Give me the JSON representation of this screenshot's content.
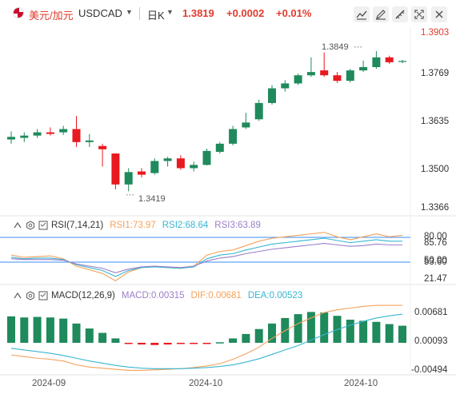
{
  "header": {
    "pair_cn": "美元/加元",
    "pair_code": "USDCAD",
    "period": "日K",
    "price": "1.3819",
    "change": "+0.0002",
    "change_pct": "+0.01%"
  },
  "toolbar": {
    "icons": [
      "chart-line-icon",
      "draw-pencil-icon",
      "ruler-icon",
      "fullscreen-icon",
      "close-icon"
    ]
  },
  "colors": {
    "up": "#1f8a5c",
    "down": "#e8191f",
    "accent_red": "#e23b2e",
    "rsi1": "#f5a15a",
    "rsi2": "#37b6d1",
    "rsi3": "#9b7fc9",
    "macd_line": "#f5a15a",
    "dea_line": "#37b6d1",
    "hist_pos": "#1f8a5c",
    "hist_neg": "#e8191f",
    "ref_line": "#3a8ef5"
  },
  "price_axis": {
    "labels": [
      "1.3903",
      "1.3769",
      "1.3635",
      "1.3500",
      "1.3366"
    ]
  },
  "annotations": {
    "high": "1.3849",
    "low": "1.3419"
  },
  "rsi": {
    "title": "RSI(7,14,21)",
    "rsi1": "RSI1:73.97",
    "rsi2": "RSI2:68.64",
    "rsi3": "RSI3:63.89",
    "axis": [
      "80.00",
      "85.76",
      "50.00",
      "53.60",
      "21.47"
    ]
  },
  "macd": {
    "title": "MACD(12,26,9)",
    "macd": "MACD:0.00315",
    "dif": "DIF:0.00681",
    "dea": "DEA:0.00523",
    "axis": [
      "0.00681",
      "0.00093",
      "-0.00494"
    ]
  },
  "x_axis": {
    "labels": [
      "2024-09",
      "2024-10",
      "2024-10"
    ]
  },
  "chart_data": {
    "type": "candlestick",
    "candles": [
      {
        "o": 1.3578,
        "c": 1.3586,
        "h": 1.3603,
        "l": 1.3565
      },
      {
        "o": 1.3583,
        "c": 1.359,
        "h": 1.36,
        "l": 1.357
      },
      {
        "o": 1.359,
        "c": 1.36,
        "h": 1.361,
        "l": 1.3583
      },
      {
        "o": 1.36,
        "c": 1.3595,
        "h": 1.3615,
        "l": 1.359
      },
      {
        "o": 1.36,
        "c": 1.361,
        "h": 1.362,
        "l": 1.3592
      },
      {
        "o": 1.361,
        "c": 1.357,
        "h": 1.365,
        "l": 1.3555
      },
      {
        "o": 1.357,
        "c": 1.3575,
        "h": 1.3595,
        "l": 1.3555
      },
      {
        "o": 1.3558,
        "c": 1.3548,
        "h": 1.3565,
        "l": 1.3495
      },
      {
        "o": 1.3535,
        "c": 1.344,
        "h": 1.3535,
        "l": 1.3425
      },
      {
        "o": 1.344,
        "c": 1.3478,
        "h": 1.349,
        "l": 1.3419
      },
      {
        "o": 1.348,
        "c": 1.347,
        "h": 1.349,
        "l": 1.3462
      },
      {
        "o": 1.3475,
        "c": 1.3512,
        "h": 1.352,
        "l": 1.347
      },
      {
        "o": 1.3512,
        "c": 1.352,
        "h": 1.3525,
        "l": 1.3495
      },
      {
        "o": 1.352,
        "c": 1.349,
        "h": 1.353,
        "l": 1.3485
      },
      {
        "o": 1.349,
        "c": 1.35,
        "h": 1.351,
        "l": 1.348
      },
      {
        "o": 1.35,
        "c": 1.3543,
        "h": 1.355,
        "l": 1.3498
      },
      {
        "o": 1.354,
        "c": 1.3565,
        "h": 1.357,
        "l": 1.3535
      },
      {
        "o": 1.3565,
        "c": 1.361,
        "h": 1.362,
        "l": 1.356
      },
      {
        "o": 1.3615,
        "c": 1.363,
        "h": 1.366,
        "l": 1.361
      },
      {
        "o": 1.364,
        "c": 1.369,
        "h": 1.37,
        "l": 1.3635
      },
      {
        "o": 1.369,
        "c": 1.3735,
        "h": 1.3745,
        "l": 1.3685
      },
      {
        "o": 1.3735,
        "c": 1.375,
        "h": 1.376,
        "l": 1.3725
      },
      {
        "o": 1.375,
        "c": 1.3775,
        "h": 1.378,
        "l": 1.3745
      },
      {
        "o": 1.3775,
        "c": 1.3785,
        "h": 1.383,
        "l": 1.377
      },
      {
        "o": 1.379,
        "c": 1.3775,
        "h": 1.3845,
        "l": 1.377
      },
      {
        "o": 1.3775,
        "c": 1.3758,
        "h": 1.3785,
        "l": 1.3752
      },
      {
        "o": 1.3758,
        "c": 1.379,
        "h": 1.3795,
        "l": 1.3753
      },
      {
        "o": 1.379,
        "c": 1.38,
        "h": 1.382,
        "l": 1.3785
      },
      {
        "o": 1.38,
        "c": 1.383,
        "h": 1.3849,
        "l": 1.3795
      },
      {
        "o": 1.383,
        "c": 1.3815,
        "h": 1.3835,
        "l": 1.381
      },
      {
        "o": 1.3817,
        "c": 1.3819,
        "h": 1.3822,
        "l": 1.3812
      }
    ],
    "rsi1": [
      55,
      52,
      53,
      54,
      50,
      40,
      35,
      30,
      20,
      32,
      38,
      40,
      38,
      37,
      40,
      55,
      60,
      62,
      68,
      74,
      78,
      80,
      82,
      84,
      86,
      80,
      76,
      80,
      84,
      80,
      82
    ],
    "rsi2": [
      52,
      50,
      51,
      51,
      49,
      42,
      38,
      34,
      26,
      34,
      38,
      39,
      38,
      37,
      39,
      50,
      55,
      57,
      62,
      66,
      70,
      72,
      74,
      76,
      78,
      75,
      72,
      74,
      76,
      74,
      74
    ],
    "rsi3": [
      50,
      49,
      49,
      49,
      48,
      43,
      40,
      37,
      31,
      36,
      39,
      40,
      39,
      38,
      40,
      47,
      51,
      53,
      57,
      60,
      63,
      65,
      67,
      69,
      71,
      69,
      67,
      68,
      70,
      69,
      69
    ],
    "macd_hist": [
      0.0048,
      0.0046,
      0.0047,
      0.0046,
      0.0044,
      0.0035,
      0.0026,
      0.0018,
      0.0008,
      -0.0002,
      -0.0003,
      -0.0004,
      -0.0003,
      -0.0002,
      -0.0001,
      -0.0001,
      0.0001,
      0.0008,
      0.0016,
      0.0025,
      0.0035,
      0.0045,
      0.0052,
      0.0056,
      0.0055,
      0.0049,
      0.0042,
      0.004,
      0.0038,
      0.0034,
      0.0031
    ],
    "dif": [
      -0.0022,
      -0.0025,
      -0.0028,
      -0.003,
      -0.0033,
      -0.004,
      -0.0044,
      -0.0046,
      -0.0048,
      -0.005,
      -0.005,
      -0.0049,
      -0.0048,
      -0.0047,
      -0.0045,
      -0.0042,
      -0.0038,
      -0.003,
      -0.002,
      -0.0008,
      0.0008,
      0.0022,
      0.0035,
      0.0045,
      0.0055,
      0.006,
      0.0063,
      0.0066,
      0.0068,
      0.0068,
      0.0068
    ],
    "dea": [
      -0.001,
      -0.0013,
      -0.0016,
      -0.0019,
      -0.0023,
      -0.0028,
      -0.0033,
      -0.0037,
      -0.0041,
      -0.0044,
      -0.0046,
      -0.0047,
      -0.0047,
      -0.0047,
      -0.0046,
      -0.0045,
      -0.0043,
      -0.004,
      -0.0035,
      -0.0029,
      -0.0021,
      -0.0013,
      -0.0005,
      0.0005,
      0.0015,
      0.0024,
      0.0032,
      0.0039,
      0.0045,
      0.0049,
      0.0052
    ],
    "price_range": [
      1.3366,
      1.3903
    ],
    "rsi_range": [
      21.47,
      85.76
    ],
    "macd_range": [
      -0.00494,
      0.00681
    ]
  }
}
